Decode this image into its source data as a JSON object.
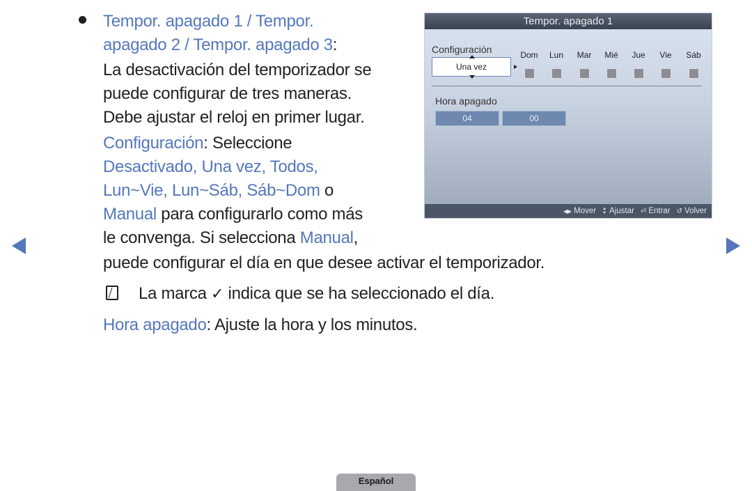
{
  "paragraph1": {
    "title_line1": "Tempor. apagado 1 / Tempor.",
    "title_line2": "apagado 2 / Tempor. apagado 3",
    "title_colon": ":",
    "lines": [
      "La desactivación del temporizador se",
      "puede configurar de tres maneras.",
      "Debe ajustar el reloj en primer lugar."
    ]
  },
  "paragraph2": {
    "term": "Configuración",
    "after_term": ": Seleccione",
    "options_line1": "Desactivado, Una vez, Todos,",
    "options_line2": "Lun~Vie, Lun~Sáb, Sáb~Dom",
    "or": " o",
    "manual": "Manual",
    "after_manual": " para configurarlo como más",
    "line5_text": "le convenga. Si selecciona ",
    "line5_manual": "Manual",
    "line5_comma": ",",
    "line6": "puede configurar el día en que desee activar el temporizador."
  },
  "note": {
    "before_check": "La marca",
    "check_glyph": "✓",
    "after_check": "indica que se ha seleccionado el día."
  },
  "paragraph3": {
    "term": "Hora apagado",
    "text": ": Ajuste la hora y los minutos."
  },
  "panel": {
    "title": "Tempor. apagado 1",
    "config_label": "Configuración",
    "config_value": "Una vez",
    "days": [
      "Dom",
      "Lun",
      "Mar",
      "Mié",
      "Jue",
      "Vie",
      "Sáb"
    ],
    "hora_label": "Hora apagado",
    "hour": "04",
    "minute": "00",
    "footer": {
      "move": {
        "icon": "◀▶",
        "label": "Mover"
      },
      "adjust": {
        "icon": "▲▼",
        "label": "Ajustar"
      },
      "enter": {
        "icon": "⏎",
        "label": "Entrar"
      },
      "back": {
        "icon": "↺",
        "label": "Volver"
      }
    }
  },
  "language_tab": "Español",
  "colors": {
    "accent": "#5577bb",
    "panel_header": "#3a4350",
    "time_field": "#6e88b0",
    "checkbox": "#8a8e94"
  }
}
